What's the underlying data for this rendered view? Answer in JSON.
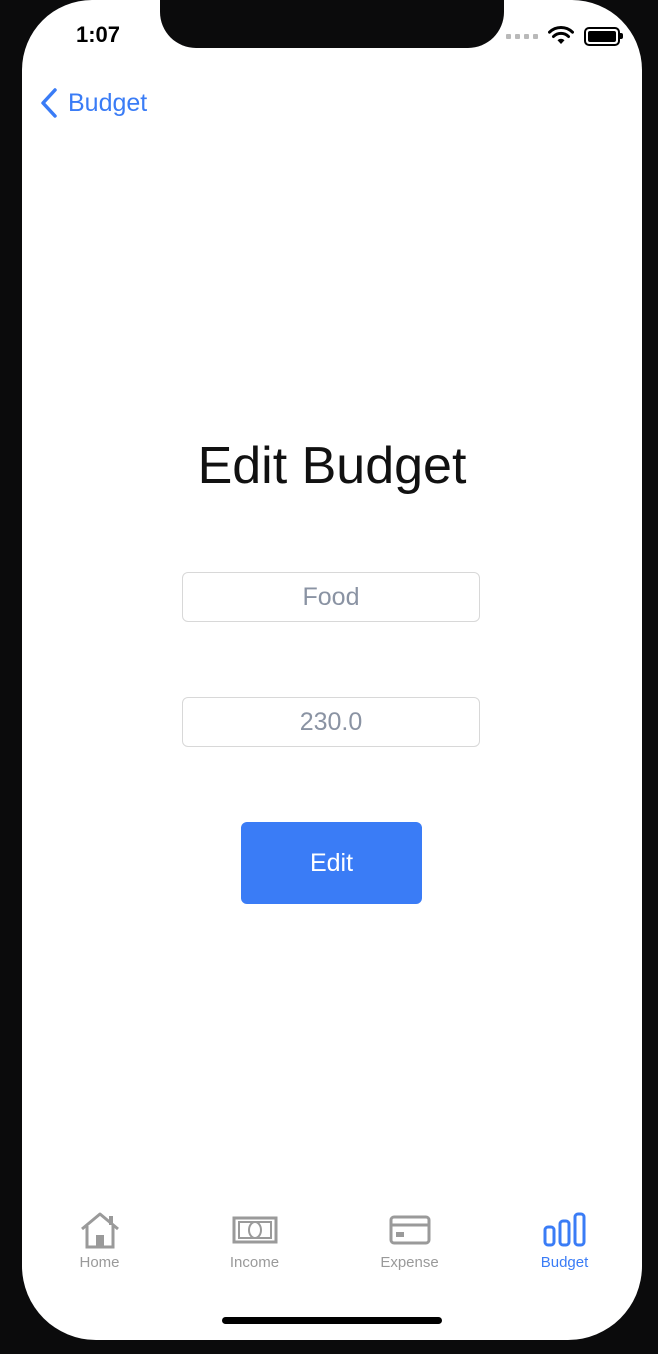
{
  "status_bar": {
    "time": "1:07"
  },
  "nav": {
    "back_label": "Budget"
  },
  "page": {
    "title": "Edit Budget",
    "name_field": {
      "placeholder": "Food",
      "value": ""
    },
    "amount_field": {
      "placeholder": "230.0",
      "value": ""
    },
    "edit_button": "Edit"
  },
  "tabbar": {
    "items": [
      {
        "label": "Home",
        "icon": "home-icon",
        "active": false
      },
      {
        "label": "Income",
        "icon": "cash-icon",
        "active": false
      },
      {
        "label": "Expense",
        "icon": "card-icon",
        "active": false
      },
      {
        "label": "Budget",
        "icon": "bar-chart-icon",
        "active": true
      }
    ]
  },
  "colors": {
    "accent": "#3a7cf6",
    "inactive_tab": "#9a9a9a",
    "placeholder": "#8a93a3"
  }
}
